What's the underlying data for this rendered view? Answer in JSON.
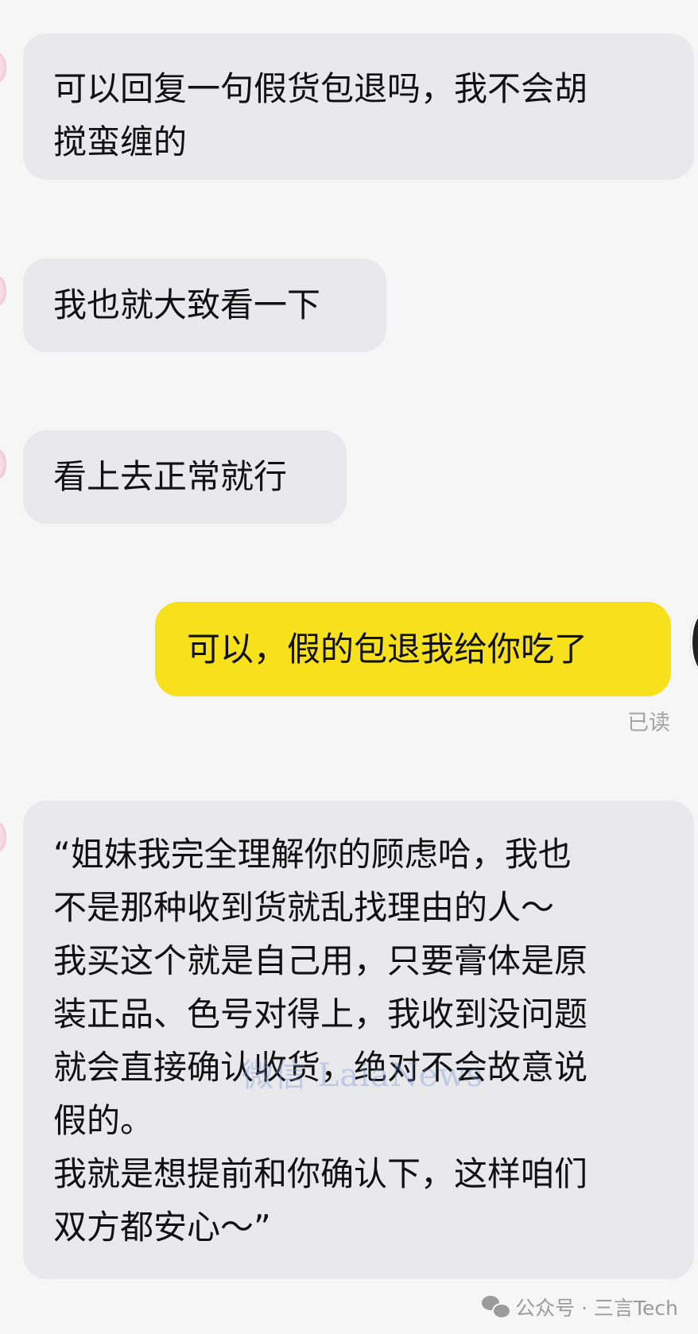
{
  "messages": [
    {
      "direction": "incoming",
      "lines": [
        "可以回复一句假货包退吗，我不会胡",
        "搅蛮缠的"
      ]
    },
    {
      "direction": "incoming",
      "lines": [
        "我也就大致看一下"
      ]
    },
    {
      "direction": "incoming",
      "lines": [
        "看上去正常就行"
      ]
    },
    {
      "direction": "outgoing",
      "lines": [
        "可以，假的包退我给你吃了"
      ],
      "status": "已读"
    },
    {
      "direction": "incoming",
      "lines": [
        "“姐妹我完全理解你的顾虑哈，我也",
        "不是那种收到货就乱找理由的人～",
        "我买这个就是自己用，只要膏体是原",
        "装正品、色号对得上，我收到没问题",
        "就会直接确认收货，绝对不会故意说",
        "假的。",
        "我就是想提前和你确认下，这样咱们",
        "双方都安心～”"
      ]
    }
  ],
  "watermark": "微信 LaiaNews",
  "source": {
    "icon": "wechat-icon",
    "label": "公众号 · 三言Tech"
  },
  "colors": {
    "background": "#f6f6f6",
    "incoming_bubble": "#e9e9eb",
    "outgoing_bubble": "#f7e11d",
    "status_text": "#a3a3a3"
  }
}
